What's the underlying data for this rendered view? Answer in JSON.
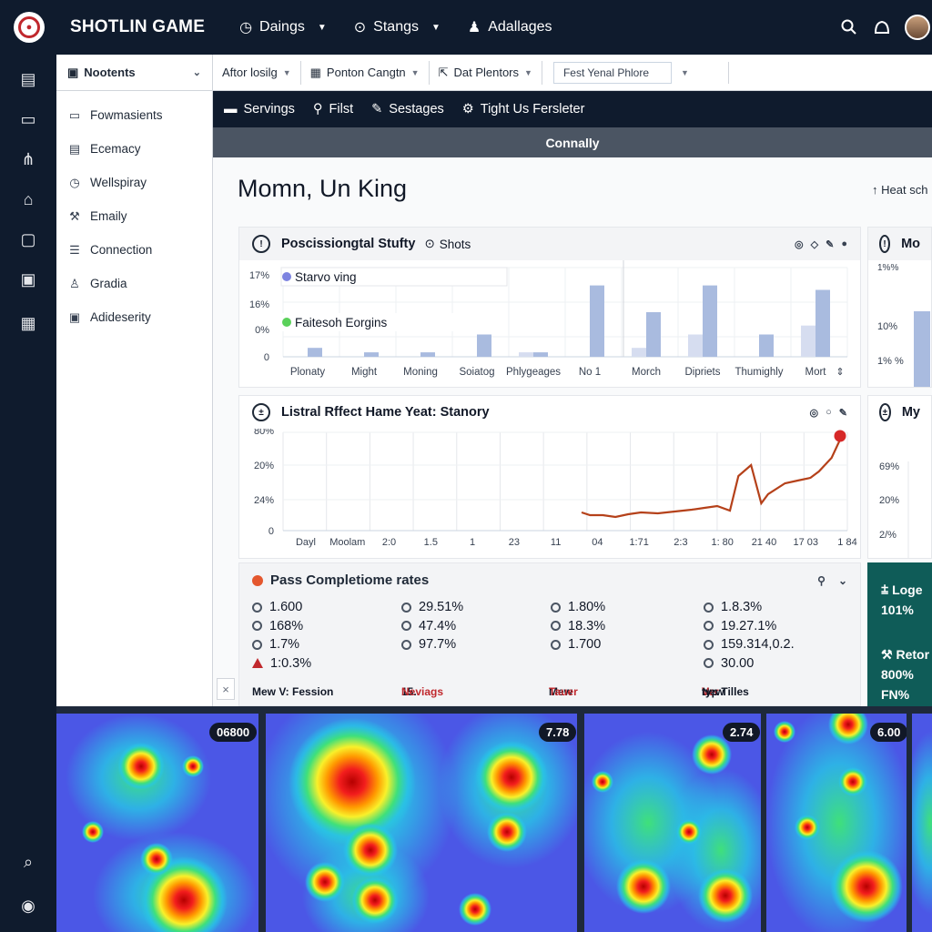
{
  "app": {
    "title": "SHOTLIN GAME"
  },
  "topnav": [
    {
      "label": "Daings",
      "icon": "clock-icon"
    },
    {
      "label": "Stangs",
      "icon": "target-icon"
    },
    {
      "label": "Adallages",
      "icon": "user-icon"
    }
  ],
  "sidebar": {
    "header": "Nootents",
    "items": [
      {
        "label": "Fowmasients",
        "icon": "folder-icon"
      },
      {
        "label": "Ecemacy",
        "icon": "document-icon"
      },
      {
        "label": "Wellspiray",
        "icon": "clock-icon"
      },
      {
        "label": "Emaily",
        "icon": "wrench-icon"
      },
      {
        "label": "Connection",
        "icon": "list-icon"
      },
      {
        "label": "Gradia",
        "icon": "bag-icon"
      },
      {
        "label": "Adideserity",
        "icon": "window-icon"
      }
    ]
  },
  "toolbar": {
    "buttons": [
      {
        "label": "Aftor losilg"
      },
      {
        "label": "Ponton Cangtn"
      },
      {
        "label": "Dat Plentors"
      }
    ],
    "input_value": "Fest Yenal Phlore"
  },
  "subnav": [
    {
      "label": "Servings"
    },
    {
      "label": "Filst"
    },
    {
      "label": "Sestages"
    },
    {
      "label": "Tight Us Fersleter"
    }
  ],
  "banner": "Connally",
  "page": {
    "title": "Momn, Un King",
    "heat_link": "Heat sch"
  },
  "card1": {
    "title": "Poscissiongtal Stufty",
    "sub": "Shots",
    "side_title": "Mo",
    "legend": [
      "Starvo ving",
      "Faitesoh Eorgins"
    ]
  },
  "card2": {
    "title": "Listral Rffect Hame Yeat: Stanory",
    "side_title": "My"
  },
  "pass": {
    "title": "Pass Completiome rates",
    "columns": [
      [
        "1.600",
        "168%",
        "1.7%",
        "1:0.3%"
      ],
      [
        "29.51%",
        "47.4%",
        "97.7%"
      ],
      [
        "1.80%",
        "18.3%",
        "1.700"
      ],
      [
        "1.8.3%",
        "19.27.1%",
        "159.314,0.2.",
        "30.00"
      ]
    ],
    "footer": {
      "a": "Mew V: Fession",
      "b_prefix": "15.",
      "b": "Neviags",
      "c_prefix": "Mew",
      "c": "Tauer",
      "d_prefix": "New",
      "d_red": "Ver",
      "d": "typ Tilles"
    }
  },
  "teal": {
    "l1": "Loge",
    "l2": "101%",
    "l3": "Retor",
    "l4": "800%",
    "l5": "FN%"
  },
  "heatmaps": [
    {
      "badge": "06800"
    },
    {
      "badge": "7.78"
    },
    {
      "badge": "2.74"
    },
    {
      "badge": "6.00"
    }
  ],
  "chart_data": [
    {
      "type": "bar",
      "title": "Poscissiongtal Stufty",
      "ytick_labels": [
        "0",
        "0%",
        "16%",
        "17%"
      ],
      "categories": [
        "Plonaty",
        "Might",
        "Moning",
        "Soiatog",
        "Phlygeages",
        "No 1",
        "Morch",
        "Dipriets",
        "Thumighly",
        "Mort"
      ],
      "series": [
        {
          "name": "Starvo ving",
          "color": "#a9bbdf",
          "values": [
            0.2,
            0.1,
            0.1,
            0.5,
            0.1,
            1.6,
            1.0,
            1.6,
            0.5,
            1.5
          ]
        },
        {
          "name": "Faitesoh Eorgins",
          "color": "#d6ddf0",
          "values": [
            0,
            0,
            0,
            0,
            0.1,
            0,
            0.2,
            0.5,
            0,
            0.7
          ]
        }
      ],
      "ylim": [
        0,
        2
      ]
    },
    {
      "type": "line",
      "title": "Listral Rffect Hame Yeat: Stanory",
      "ytick_labels": [
        "0",
        "24%",
        "20%",
        "80%"
      ],
      "xtick_labels": [
        "Dayl",
        "Moolam",
        "2:0",
        "1.5",
        "1",
        "23",
        "11",
        "04",
        "1:71",
        "2:3",
        "1: 80",
        "21 40",
        "17 03",
        "1 84"
      ],
      "series": [
        {
          "color": "#b5411a",
          "points": [
            [
              0,
              0.2
            ],
            [
              0.1,
              0.17
            ],
            [
              0.25,
              0.17
            ],
            [
              0.4,
              0.15
            ],
            [
              0.55,
              0.18
            ],
            [
              0.7,
              0.2
            ],
            [
              0.9,
              0.19
            ],
            [
              1.1,
              0.21
            ],
            [
              1.3,
              0.23
            ],
            [
              1.45,
              0.25
            ],
            [
              1.6,
              0.27
            ],
            [
              1.75,
              0.22
            ],
            [
              1.85,
              0.6
            ],
            [
              2.0,
              0.72
            ],
            [
              2.12,
              0.3
            ],
            [
              2.2,
              0.4
            ],
            [
              2.4,
              0.52
            ],
            [
              2.55,
              0.55
            ],
            [
              2.7,
              0.58
            ],
            [
              2.8,
              0.65
            ],
            [
              2.95,
              0.8
            ],
            [
              3.05,
              1.0
            ]
          ]
        }
      ],
      "marker_color": "#d62828"
    }
  ]
}
